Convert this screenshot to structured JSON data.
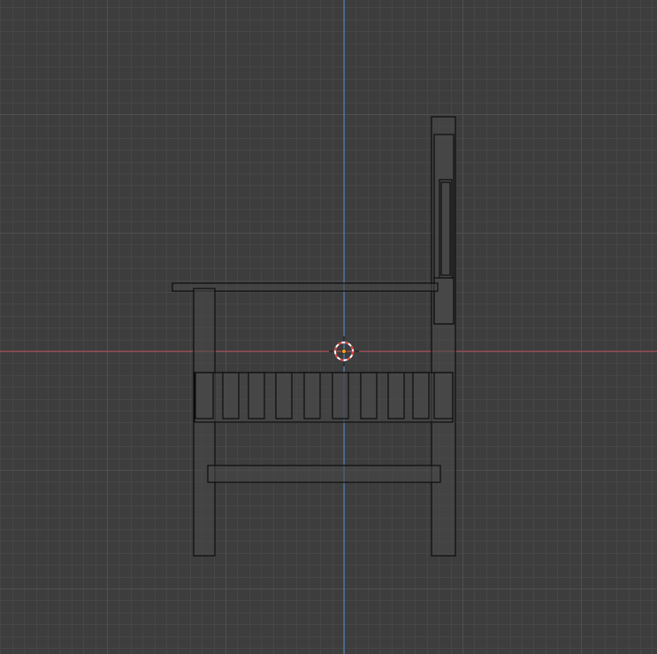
{
  "colors": {
    "background": "#3d3d3d",
    "grid_minor": "#464646",
    "grid_major": "#4f4f4f",
    "axis_x": "#a34d55",
    "axis_y": "#4d7fb8",
    "mesh_fill": "#494949",
    "mesh_edge": "#0d0d0d",
    "cursor_ring_red": "#e04040",
    "cursor_ring_white": "#ffffff",
    "origin_dot": "#f0a020"
  },
  "icons": {
    "cursor": "3d-cursor-icon",
    "origin": "object-origin-icon"
  }
}
